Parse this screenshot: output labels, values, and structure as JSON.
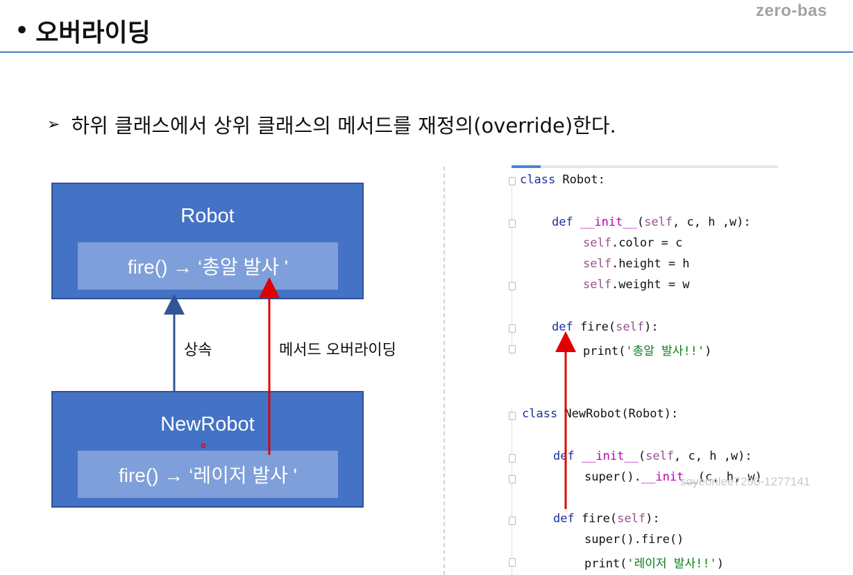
{
  "brand": "zero-bas",
  "slide": {
    "title": "오버라이딩",
    "bullet": "하위 클래스에서 상위 클래스의 메서드를 재정의(override)한다."
  },
  "diagram": {
    "parent": {
      "name": "Robot",
      "method": "fire() → ‘총알 발사 '"
    },
    "child": {
      "name": "NewRobot",
      "method": "fire() → ‘레이저 발사 '"
    },
    "inherit_label": "상속",
    "override_label": "메서드 오버라이딩"
  },
  "code": {
    "l1": [
      "class",
      " Robot:"
    ],
    "l2": [
      "def ",
      "__init__",
      "(",
      "self",
      ", c, h ,w):"
    ],
    "l3": [
      "self",
      ".color = c"
    ],
    "l4": [
      "self",
      ".height = h"
    ],
    "l5": [
      "self",
      ".weight = w"
    ],
    "l6": [
      "def ",
      "fire(",
      "self",
      "):"
    ],
    "l7": [
      "print(",
      "'총알 발사!!'",
      ")"
    ],
    "l8": [
      "class",
      " NewRobot(Robot):"
    ],
    "l9": [
      "def ",
      "__init__",
      "(",
      "self",
      ", c, h ,w):"
    ],
    "l10": [
      "super().",
      "__init__",
      "(c, h, w)"
    ],
    "l11": [
      "def ",
      "fire(",
      "self",
      "):"
    ],
    "l12": "super().fire()",
    "l13": [
      "print(",
      "'레이저 발사!!'",
      ")"
    ]
  },
  "watermark": "soyeonlee7290-1277141",
  "colors": {
    "box_fill": "#4472c4",
    "method_fill": "#7f9fda",
    "inherit_arrow": "#2f5597",
    "override_arrow": "#e00000",
    "rule": "#4a79c4"
  }
}
